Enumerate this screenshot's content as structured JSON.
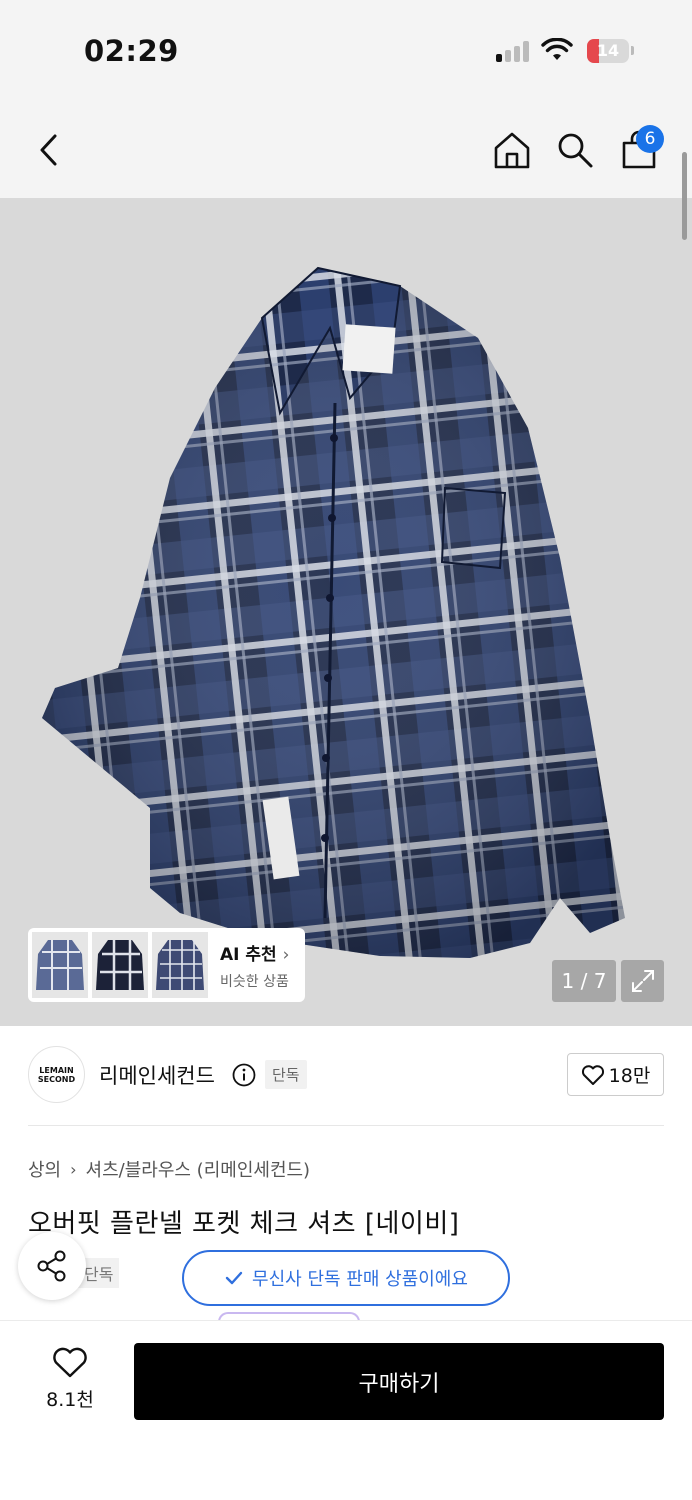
{
  "status_bar": {
    "time": "02:29",
    "battery": "14",
    "battery_color": "#e5484d"
  },
  "header": {
    "back_icon": "chevron-left-icon",
    "home_icon": "home-icon",
    "search_icon": "search-icon",
    "cart_icon": "shopping-bag-icon",
    "cart_count": "6",
    "badge_color": "#1a73e8"
  },
  "gallery": {
    "ai_recommend": {
      "title": "AI 추천",
      "subtitle": "비슷한 상품"
    },
    "page_counter": "1 / 7",
    "expand_icon": "expand-icon"
  },
  "brand": {
    "logo_line1": "LEMAIN",
    "logo_line2": "SECOND",
    "name": "리메인세컨드",
    "exclusive_tag": "단독",
    "likes": "18만"
  },
  "product": {
    "breadcrumb": [
      "상의",
      "셔츠/블라우스 (리메인세컨드)"
    ],
    "title": "오버핏 플란넬 포켓 체크 셔츠 [네이비]",
    "exclusive_tag_partial": "단독",
    "toast": "무신사 단독 판매 상품이에요",
    "accent_color": "#2f6fde"
  },
  "bottom_bar": {
    "wish_count": "8.1천",
    "buy_label": "구매하기"
  }
}
